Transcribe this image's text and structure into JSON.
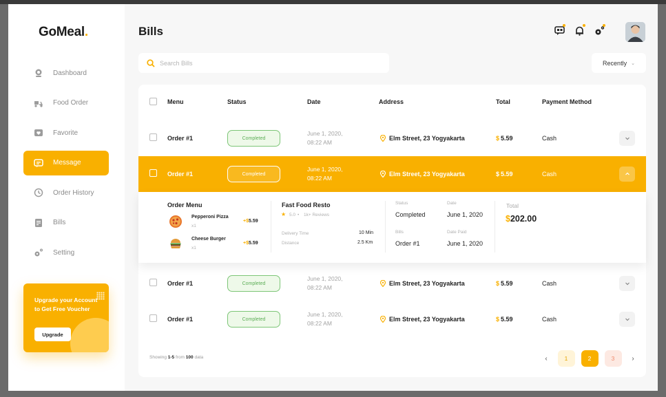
{
  "app": {
    "name": "GoMeal",
    "name_dot": "."
  },
  "sidebar": {
    "items": [
      {
        "label": "Dashboard",
        "icon": "dashboard-icon"
      },
      {
        "label": "Food Order",
        "icon": "delivery-icon"
      },
      {
        "label": "Favorite",
        "icon": "favorite-icon"
      },
      {
        "label": "Message",
        "icon": "message-icon"
      },
      {
        "label": "Order History",
        "icon": "history-icon"
      },
      {
        "label": "Bills",
        "icon": "bills-icon"
      },
      {
        "label": "Setting",
        "icon": "setting-icon"
      }
    ],
    "active_index": 3,
    "upgrade": {
      "text": "Upgrade your Account to Get Free Voucher",
      "button": "Upgrade"
    }
  },
  "header": {
    "title": "Bills"
  },
  "search": {
    "placeholder": "Search Bills",
    "value": ""
  },
  "sort": {
    "label": "Recently"
  },
  "table": {
    "columns": [
      "Menu",
      "Status",
      "Date",
      "Address",
      "Total",
      "Payment Method"
    ],
    "rows": [
      {
        "order": "Order #1",
        "status": "Completed",
        "date_line1": "June 1, 2020,",
        "date_line2": "08:22 AM",
        "address": "Elm Street, 23 Yogyakarta",
        "currency": "$",
        "total": "5.59",
        "payment": "Cash"
      },
      {
        "order": "Order #1",
        "status": "Completed",
        "date_line1": "June 1, 2020,",
        "date_line2": "08:22 AM",
        "address": "Elm Street, 23 Yogyakarta",
        "currency": "$",
        "total": "5.59",
        "payment": "Cash"
      },
      {
        "order": "Order #1",
        "status": "Completed",
        "date_line1": "June 1, 2020,",
        "date_line2": "08:22 AM",
        "address": "Elm Street, 23 Yogyakarta",
        "currency": "$",
        "total": "5.59",
        "payment": "Cash"
      },
      {
        "order": "Order #1",
        "status": "Completed",
        "date_line1": "June 1, 2020,",
        "date_line2": "08:22 AM",
        "address": "Elm Street, 23 Yogyakarta",
        "currency": "$",
        "total": "5.59",
        "payment": "Cash"
      }
    ],
    "expanded_row": 1
  },
  "detail": {
    "order_menu_title": "Order Menu",
    "items": [
      {
        "name": "Pepperoni Pizza",
        "qty": "x1",
        "price_prefix": "+",
        "currency": "$",
        "price": "5.59"
      },
      {
        "name": "Cheese Burger",
        "qty": "x1",
        "price_prefix": "+",
        "currency": "$",
        "price": "5.59"
      }
    ],
    "restaurant": {
      "name": "Fast Food Resto",
      "rating": "5.0",
      "reviews": "1k+ Reviews",
      "delivery_time_label": "Delivery Time",
      "delivery_time": "10 Min",
      "distance_label": "Distance",
      "distance": "2.5 Km"
    },
    "status_label": "Status",
    "status": "Completed",
    "date_label": "Date",
    "date": "June 1, 2020",
    "bills_label": "Bills",
    "bills": "Order #1",
    "date_paid_label": "Date Paid",
    "date_paid": "June 1, 2020",
    "total_label": "Total",
    "total_currency": "$",
    "total": "202.00"
  },
  "footer": {
    "showing_prefix": "Showing",
    "range": "1-5",
    "from": "from",
    "count": "100",
    "suffix": "data"
  },
  "pagination": {
    "pages": [
      "1",
      "2",
      "3"
    ],
    "current": "2",
    "prev": "‹",
    "next": "›"
  },
  "colors": {
    "accent": "#f9b000",
    "success": "#5dae57"
  }
}
